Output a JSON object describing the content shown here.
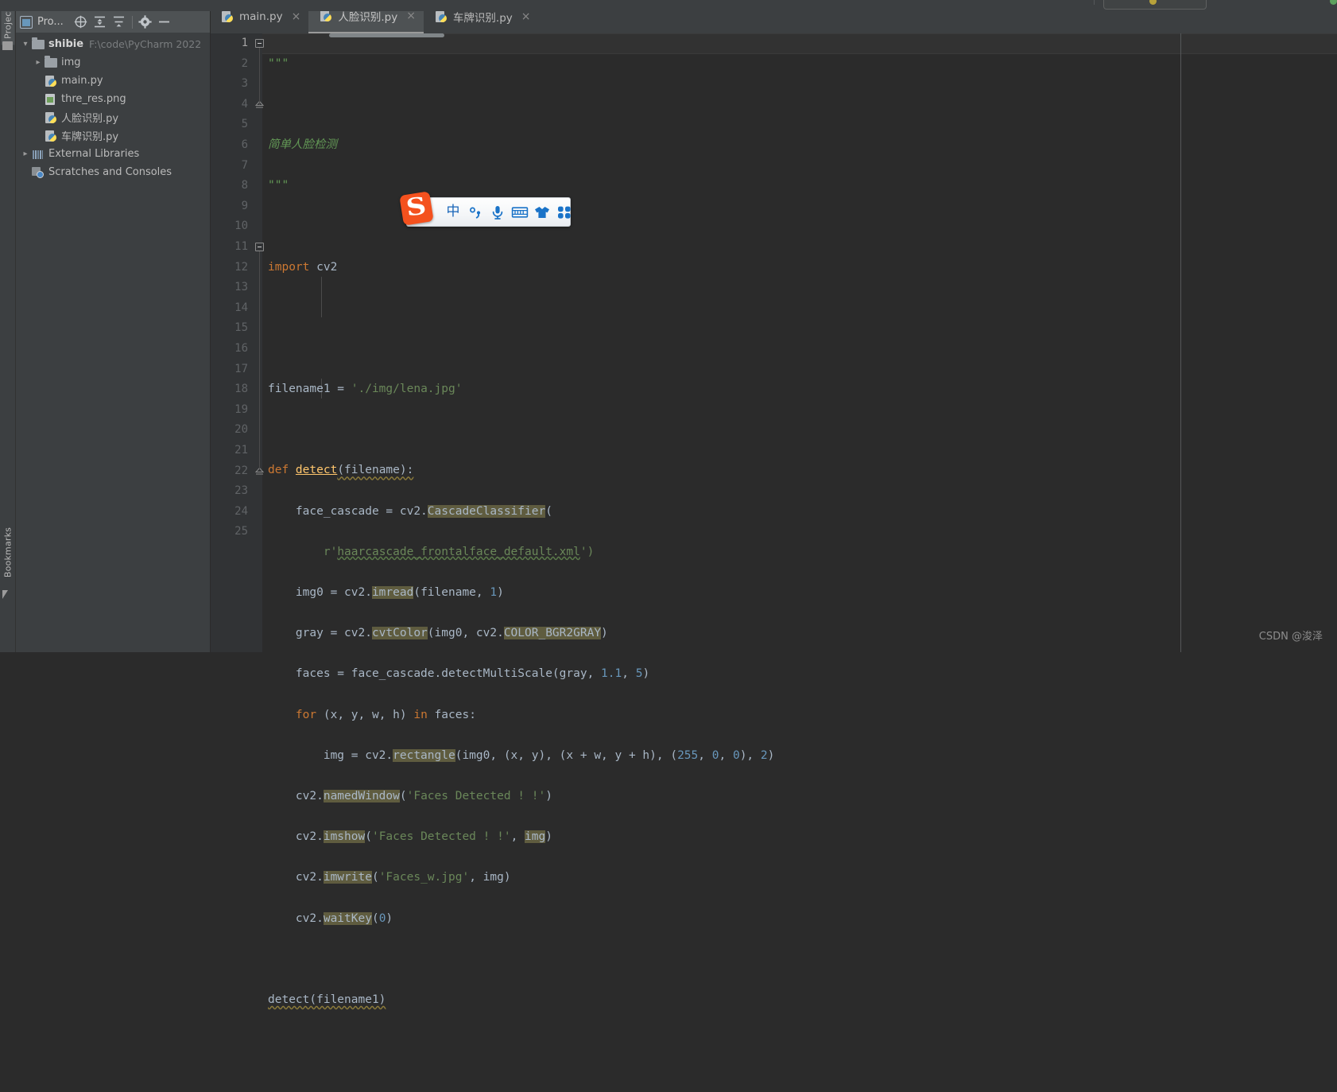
{
  "window": {
    "watermark": "CSDN @浚泽"
  },
  "left_strip": {
    "project_tab": "Project",
    "bookmarks_tab": "Bookmarks",
    "folder_icon": "folder-icon",
    "bookmark_icon": "bookmark-icon"
  },
  "project_panel": {
    "title": "Pro...",
    "icons": [
      {
        "name": "select-opened-file-icon",
        "glyph": "target-icon"
      },
      {
        "name": "expand-all-icon",
        "glyph": "expand-all-icon"
      },
      {
        "name": "collapse-all-icon",
        "glyph": "collapse-all-icon"
      },
      {
        "name": "settings-icon",
        "glyph": "gear-icon"
      },
      {
        "name": "hide-icon",
        "glyph": "minimize-icon"
      }
    ],
    "tree": [
      {
        "label": "shibie",
        "sub": "F:\\code\\PyCharm 2022",
        "icon": "folder-icon",
        "arrow": "expanded",
        "bold": true,
        "indent": 0
      },
      {
        "label": "img",
        "sub": "",
        "icon": "folder-icon",
        "arrow": "collapsed",
        "bold": false,
        "indent": 1
      },
      {
        "label": "main.py",
        "sub": "",
        "icon": "python-file-icon",
        "arrow": "none",
        "bold": false,
        "indent": 1
      },
      {
        "label": "thre_res.png",
        "sub": "",
        "icon": "image-file-icon",
        "arrow": "none",
        "bold": false,
        "indent": 1
      },
      {
        "label": "人脸识别.py",
        "sub": "",
        "icon": "python-file-icon",
        "arrow": "none",
        "bold": false,
        "indent": 1
      },
      {
        "label": "车牌识别.py",
        "sub": "",
        "icon": "python-file-icon",
        "arrow": "none",
        "bold": false,
        "indent": 1
      },
      {
        "label": "External Libraries",
        "sub": "",
        "icon": "library-icon",
        "arrow": "collapsed",
        "bold": false,
        "indent": 0
      },
      {
        "label": "Scratches and Consoles",
        "sub": "",
        "icon": "scratches-icon",
        "arrow": "none",
        "bold": false,
        "indent": 0
      }
    ]
  },
  "editor": {
    "tabs": [
      {
        "label": "main.py",
        "active": false,
        "close": "×",
        "icon": "python-file-icon"
      },
      {
        "label": "人脸识别.py",
        "active": true,
        "close": "×",
        "icon": "python-file-icon"
      },
      {
        "label": "车牌识别.py",
        "active": false,
        "close": "×",
        "icon": "python-file-icon"
      }
    ],
    "line_numbers": [
      "1",
      "2",
      "3",
      "4",
      "5",
      "6",
      "7",
      "8",
      "9",
      "10",
      "11",
      "12",
      "13",
      "14",
      "15",
      "16",
      "17",
      "18",
      "19",
      "20",
      "21",
      "22",
      "23",
      "24",
      "25"
    ],
    "current_line": 1,
    "code_lines": [
      {
        "n": 1,
        "text": "\"\"\""
      },
      {
        "n": 2,
        "text": ""
      },
      {
        "n": 3,
        "text": "简单人脸检测"
      },
      {
        "n": 4,
        "text": "\"\"\""
      },
      {
        "n": 5,
        "text": ""
      },
      {
        "n": 6,
        "text": "import cv2"
      },
      {
        "n": 7,
        "text": ""
      },
      {
        "n": 8,
        "text": ""
      },
      {
        "n": 9,
        "text": "filename1 = './img/lena.jpg'"
      },
      {
        "n": 10,
        "text": ""
      },
      {
        "n": 11,
        "text": "def detect(filename):"
      },
      {
        "n": 12,
        "text": "    face_cascade = cv2.CascadeClassifier("
      },
      {
        "n": 13,
        "text": "        r'haarcascade_frontalface_default.xml')"
      },
      {
        "n": 14,
        "text": "    img0 = cv2.imread(filename, 1)"
      },
      {
        "n": 15,
        "text": "    gray = cv2.cvtColor(img0, cv2.COLOR_BGR2GRAY)"
      },
      {
        "n": 16,
        "text": "    faces = face_cascade.detectMultiScale(gray, 1.1, 5)"
      },
      {
        "n": 17,
        "text": "    for (x, y, w, h) in faces:"
      },
      {
        "n": 18,
        "text": "        img = cv2.rectangle(img0, (x, y), (x + w, y + h), (255, 0, 0), 2)"
      },
      {
        "n": 19,
        "text": "    cv2.namedWindow('Faces Detected ! !')"
      },
      {
        "n": 20,
        "text": "    cv2.imshow('Faces Detected ! !', img)"
      },
      {
        "n": 21,
        "text": "    cv2.imwrite('Faces_w.jpg', img)"
      },
      {
        "n": 22,
        "text": "    cv2.waitKey(0)"
      },
      {
        "n": 23,
        "text": ""
      },
      {
        "n": 24,
        "text": "detect(filename1)"
      },
      {
        "n": 25,
        "text": ""
      }
    ],
    "colors": {
      "background": "#2b2b2b",
      "gutter": "#313335",
      "keyword": "#cc7832",
      "string": "#6a8759",
      "number": "#6897bb",
      "docstring": "#629755",
      "function_name": "#ffc66d",
      "default_text": "#a9b7c6",
      "usage_highlight": "#5f5c3f",
      "tab_active": "#4e5254",
      "panel": "#3c3f41"
    }
  },
  "ime_toolbar": {
    "logo": "sogou-logo-icon",
    "logo_letter": "S",
    "items": [
      {
        "name": "chinese-mode-icon",
        "glyph": "中"
      },
      {
        "name": "punctuation-mode-icon",
        "glyph": "punct"
      },
      {
        "name": "voice-input-icon",
        "glyph": "mic"
      },
      {
        "name": "soft-keyboard-icon",
        "glyph": "keyboard"
      },
      {
        "name": "skin-icon",
        "glyph": "shirt"
      },
      {
        "name": "toolbox-icon",
        "glyph": "grid"
      }
    ]
  }
}
